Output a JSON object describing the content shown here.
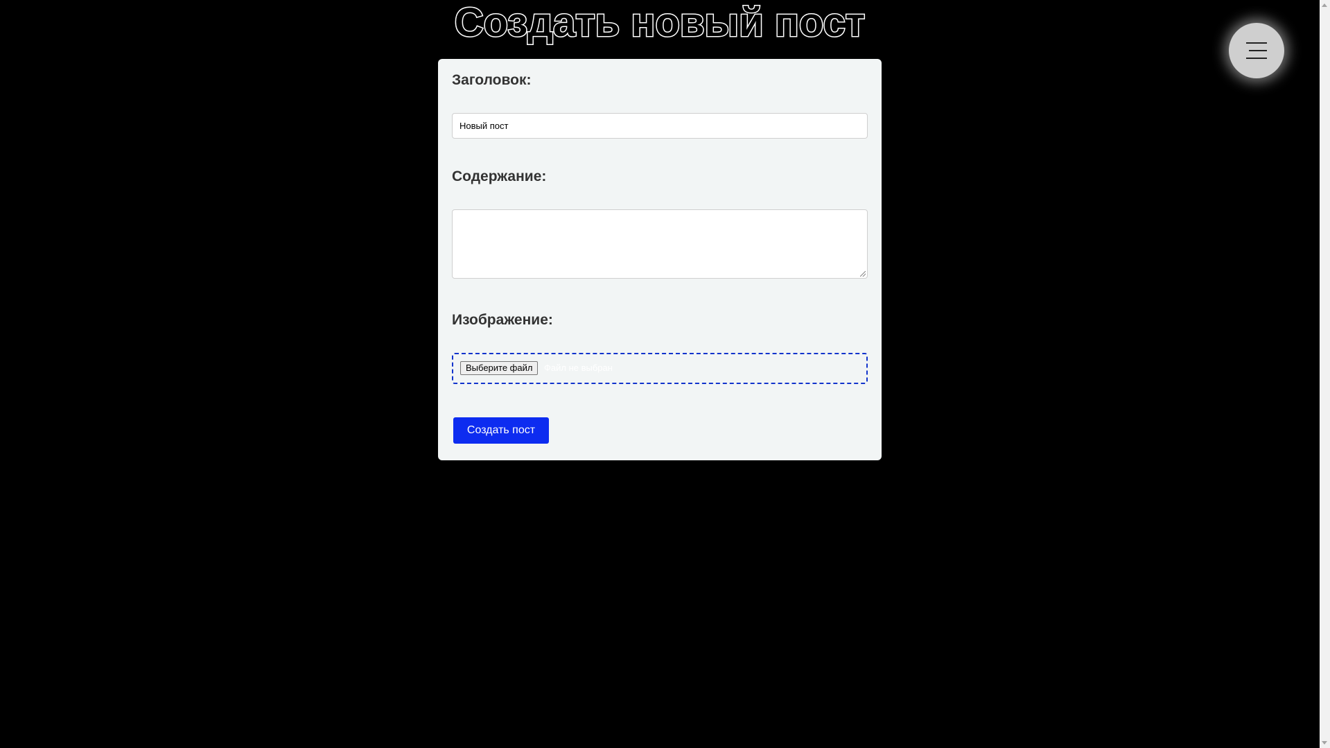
{
  "page": {
    "title": "Создать новый пост"
  },
  "menu": {
    "icon": "hamburger-menu-icon"
  },
  "form": {
    "title_label": "Заголовок:",
    "title_value": "Новый пост",
    "content_label": "Содержание:",
    "content_value": "",
    "image_label": "Изображение:",
    "file_button_label": "Выберите файл",
    "file_status": "Файл не выбран",
    "submit_label": "Создать пост"
  },
  "colors": {
    "background": "#000000",
    "card": "#f2f5f5",
    "accent": "#0d2cf0",
    "dashed_border": "#1133cc",
    "menu_button": "#cfcfcf"
  }
}
